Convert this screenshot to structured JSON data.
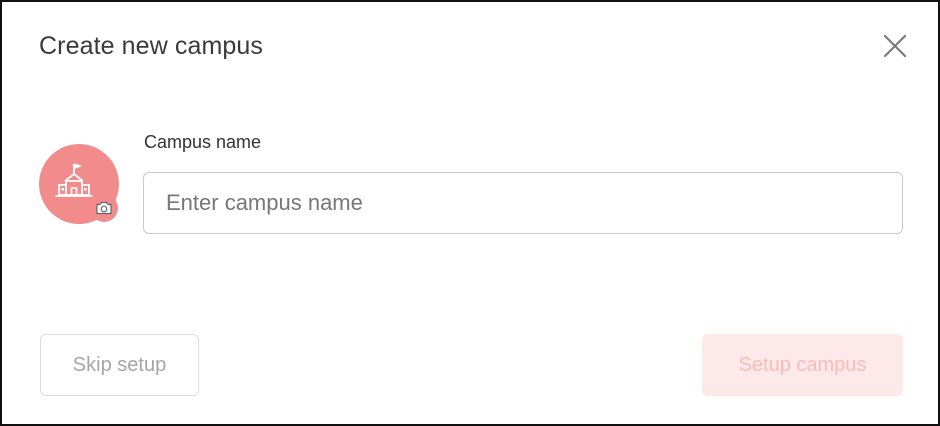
{
  "dialog": {
    "title": "Create new campus",
    "close_icon": "close-icon"
  },
  "avatar": {
    "icon": "school-building-icon",
    "badge_icon": "camera-icon",
    "background_color": "#f28b8b"
  },
  "form": {
    "campus_name_label": "Campus name",
    "campus_name_value": "",
    "campus_name_placeholder": "Enter campus name"
  },
  "actions": {
    "skip_label": "Skip setup",
    "setup_label": "Setup campus",
    "setup_disabled": true,
    "setup_color": "#fde9e9"
  }
}
